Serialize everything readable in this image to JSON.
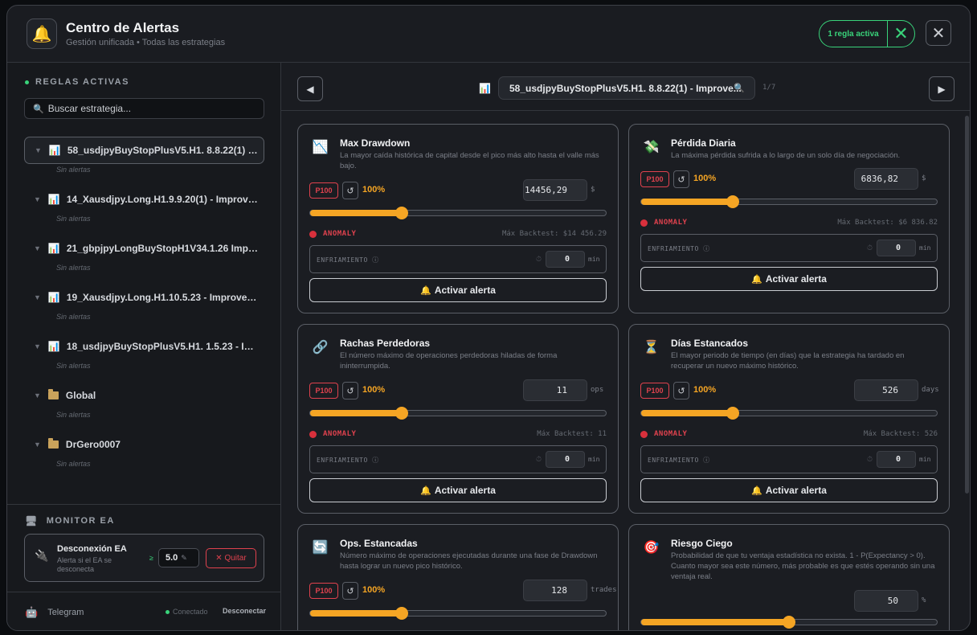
{
  "header": {
    "title": "Centro de Alertas",
    "subtitle": "Gestión unificada • Todas las estrategias",
    "active_rules": "1 regla activa"
  },
  "sidebar": {
    "section_title": "REGLAS ACTIVAS",
    "search_placeholder": "Buscar estrategia...",
    "strategies": [
      {
        "name": "58_usdjpyBuyStopPlusV5.H1. 8.8.22(1) - I...",
        "status": "Sin alertas"
      },
      {
        "name": "14_Xausdjpy.Long.H1.9.9.20(1) - Improve...",
        "status": "Sin alertas"
      },
      {
        "name": "21_gbpjpyLongBuyStopH1V34.1.26 Impr...",
        "status": "Sin alertas"
      },
      {
        "name": "19_Xausdjpy.Long.H1.10.5.23 - Improved ...",
        "status": "Sin alertas"
      },
      {
        "name": "18_usdjpyBuyStopPlusV5.H1. 1.5.23 - Imp...",
        "status": "Sin alertas"
      },
      {
        "name": "Global",
        "status": "Sin alertas"
      },
      {
        "name": "DrGero0007",
        "status": "Sin alertas"
      }
    ],
    "monitor": {
      "title": "MONITOR EA",
      "item_title": "Desconexión EA",
      "item_desc": "Alerta si el EA se desconecta",
      "comparator": "≥",
      "value": "5.0",
      "remove_label": "✕ Quitar"
    },
    "telegram": {
      "label": "Telegram",
      "status": "Conectado",
      "disconnect": "Desconectar"
    }
  },
  "main": {
    "selected_strategy": "58_usdjpyBuyStopPlusV5.H1. 8.8.22(1) - Improve...",
    "pager": "1/7",
    "cards": [
      {
        "title": "Max Drawdown",
        "desc": "La mayor caída histórica de capital desde el pico más alto hasta el valle más bajo.",
        "badge": "P100",
        "pct": "100%",
        "value": "14456,29",
        "unit": "$",
        "slider_fraction": 0.31,
        "anomaly": "ANOMALY",
        "max_backtest": "Máx Backtest: $14 456.29",
        "cooldown_label": "ENFRIAMIENTO ⓘ",
        "cooldown_value": "0",
        "cooldown_unit": "min",
        "action": "Activar alerta"
      },
      {
        "title": "Pérdida Diaria",
        "desc": "La máxima pérdida sufrida a lo largo de un solo día de negociación.",
        "badge": "P100",
        "pct": "100%",
        "value": "6836,82",
        "unit": "$",
        "slider_fraction": 0.31,
        "anomaly": "ANOMALY",
        "max_backtest": "Máx Backtest: $6 836.82",
        "cooldown_label": "ENFRIAMIENTO ⓘ",
        "cooldown_value": "0",
        "cooldown_unit": "min",
        "action": "Activar alerta"
      },
      {
        "title": "Rachas Perdedoras",
        "desc": "El número máximo de operaciones perdedoras hiladas de forma ininterrumpida.",
        "badge": "P100",
        "pct": "100%",
        "value": "11",
        "unit": "ops",
        "slider_fraction": 0.31,
        "anomaly": "ANOMALY",
        "max_backtest": "Máx Backtest: 11",
        "cooldown_label": "ENFRIAMIENTO ⓘ",
        "cooldown_value": "0",
        "cooldown_unit": "min",
        "action": "Activar alerta"
      },
      {
        "title": "Días Estancados",
        "desc": "El mayor periodo de tiempo (en días) que la estrategia ha tardado en recuperar un nuevo máximo histórico.",
        "badge": "P100",
        "pct": "100%",
        "value": "526",
        "unit": "days",
        "slider_fraction": 0.31,
        "anomaly": "ANOMALY",
        "max_backtest": "Máx Backtest: 526",
        "cooldown_label": "ENFRIAMIENTO ⓘ",
        "cooldown_value": "0",
        "cooldown_unit": "min",
        "action": "Activar alerta"
      },
      {
        "title": "Ops. Estancadas",
        "desc": "Número máximo de operaciones ejecutadas durante una fase de Drawdown hasta lograr un nuevo pico histórico.",
        "badge": "P100",
        "pct": "100%",
        "value": "128",
        "unit": "trades",
        "slider_fraction": 0.31
      },
      {
        "title": "Riesgo Ciego",
        "desc": "Probabilidad de que tu ventaja estadística no exista. 1 - P(Expectancy > 0). Cuanto mayor sea este número, más probable es que estés operando sin una ventaja real.",
        "value": "50",
        "unit": "%",
        "slider_fraction": 0.5
      }
    ]
  },
  "colors": {
    "accent": "#f5a524",
    "danger": "#e0424e",
    "success": "#39d37a",
    "background": "#1a1c21"
  }
}
